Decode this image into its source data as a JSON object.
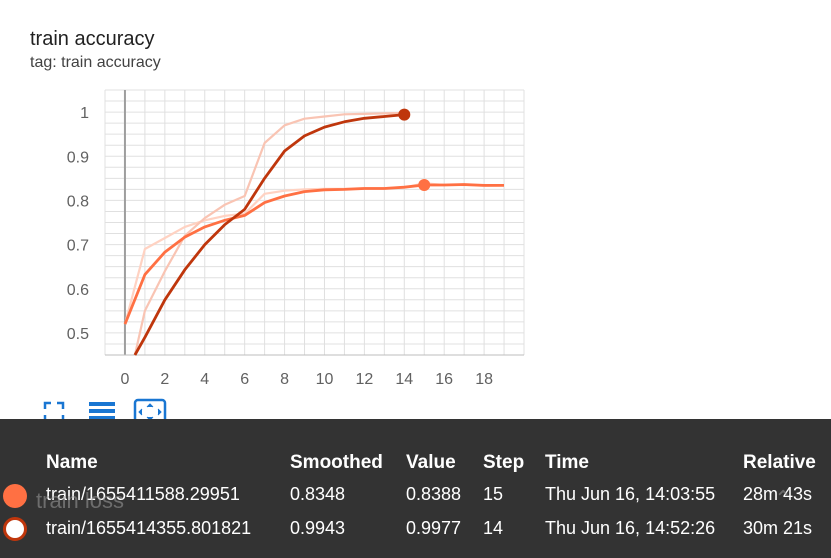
{
  "card": {
    "title": "train accuracy",
    "tag": "tag: train accuracy"
  },
  "toolbar": {
    "fullscreen_icon": "fullscreen-icon",
    "data_table_icon": "data-table-icon",
    "fit_domain_icon": "fit-to-domain-icon"
  },
  "chart_data": {
    "type": "line",
    "xlabel": "",
    "ylabel": "",
    "xlim": [
      -1,
      20
    ],
    "ylim": [
      0.45,
      1.05
    ],
    "xticks": [
      0,
      2,
      4,
      6,
      8,
      10,
      12,
      14,
      16,
      18
    ],
    "yticks": [
      0.5,
      0.6,
      0.7,
      0.8,
      0.9,
      1
    ],
    "grid": true,
    "series": [
      {
        "name": "train/1655411588.29951",
        "color": "#ff7043",
        "raw_color": "#ffd2c2",
        "raw_x": [
          0,
          1,
          2,
          3,
          4,
          5,
          6,
          7,
          8,
          9,
          10,
          11,
          12,
          13,
          14,
          15,
          16,
          17,
          18,
          19
        ],
        "raw_values": [
          0.52,
          0.69,
          0.715,
          0.74,
          0.755,
          0.765,
          0.77,
          0.815,
          0.822,
          0.825,
          0.826,
          0.826,
          0.828,
          0.828,
          0.829,
          0.839,
          0.835,
          0.835,
          0.833,
          0.834
        ],
        "smoothed_x": [
          0,
          1,
          2,
          3,
          4,
          5,
          6,
          7,
          8,
          9,
          10,
          11,
          12,
          13,
          14,
          15,
          16,
          17,
          18,
          19
        ],
        "smoothed_values": [
          0.52,
          0.632,
          0.683,
          0.717,
          0.74,
          0.755,
          0.766,
          0.795,
          0.81,
          0.82,
          0.824,
          0.825,
          0.827,
          0.827,
          0.83,
          0.835,
          0.835,
          0.836,
          0.834,
          0.834
        ],
        "hover": {
          "x": 15,
          "y": 0.8348
        }
      },
      {
        "name": "train/1655414355.801821",
        "color": "#bf360c",
        "raw_color": "#f9c4b3",
        "raw_x": [
          0.5,
          1,
          2,
          3,
          4,
          5,
          6,
          7,
          8,
          9,
          10,
          11,
          12,
          13,
          14
        ],
        "raw_values": [
          0.45,
          0.55,
          0.64,
          0.72,
          0.76,
          0.79,
          0.81,
          0.93,
          0.97,
          0.985,
          0.99,
          0.995,
          0.996,
          0.997,
          0.998
        ],
        "smoothed_x": [
          0.5,
          1,
          2,
          3,
          4,
          5,
          6,
          7,
          8,
          9,
          10,
          11,
          12,
          13,
          14
        ],
        "smoothed_values": [
          0.45,
          0.49,
          0.575,
          0.643,
          0.7,
          0.745,
          0.78,
          0.85,
          0.912,
          0.946,
          0.966,
          0.978,
          0.986,
          0.99,
          0.9943
        ],
        "hover": {
          "x": 14,
          "y": 0.9943
        }
      }
    ]
  },
  "tooltip": {
    "columns": [
      "Name",
      "Smoothed",
      "Value",
      "Step",
      "Time",
      "Relative"
    ],
    "rows": [
      {
        "name": "train/1655411588.29951",
        "smoothed": "0.8348",
        "value": "0.8388",
        "step": "15",
        "time": "Thu Jun 16, 14:03:55",
        "relative": "28m 43s",
        "color": "#ff7043",
        "marker": "filled"
      },
      {
        "name": "train/1655414355.801821",
        "smoothed": "0.9943",
        "value": "0.9977",
        "step": "14",
        "time": "Thu Jun 16, 14:52:26",
        "relative": "30m 21s",
        "color": "#bf360c",
        "marker": "ring"
      }
    ]
  },
  "occluded": {
    "next_card_title": "train loss",
    "chevron": "chevron-up-icon"
  }
}
